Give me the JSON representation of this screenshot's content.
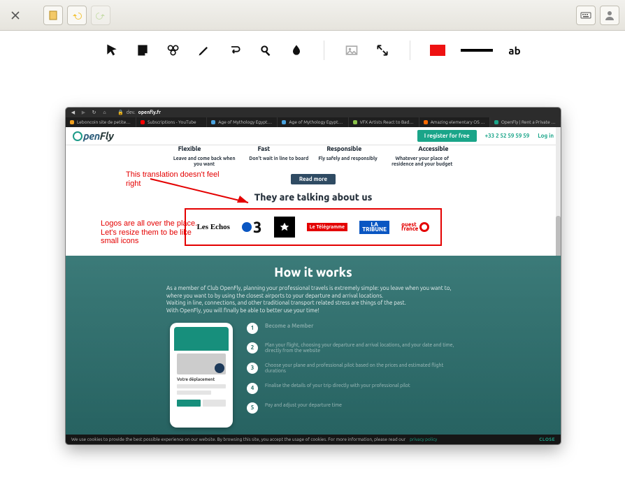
{
  "host": {
    "close": "close",
    "undo": "undo",
    "redo": "redo"
  },
  "tools": {
    "aa": "ab"
  },
  "browser": {
    "url_host": "openfly.fr",
    "url_prefix": "dev.",
    "tabs": [
      {
        "fav": "#f0a020",
        "label": "Leboncoin site de petites annonces g…"
      },
      {
        "fav": "#ff0000",
        "label": "Subscriptions - YouTube"
      },
      {
        "fav": "#4aa3df",
        "label": "Age of Mythology Egypt Campaign P…"
      },
      {
        "fav": "#4aa3df",
        "label": "Age of Mythology Egypt Campaign P…"
      },
      {
        "fav": "#8bc34a",
        "label": "VFX Artists React to Bad & Great CGI…"
      },
      {
        "fav": "#ff6a00",
        "label": "Amazing elementary OS apps that yo…"
      },
      {
        "fav": "#1aa589",
        "label": "OpenFly | Rent a Private Plane"
      }
    ],
    "active_tab": 6
  },
  "site": {
    "brand1": "pen",
    "brand2": "Fly",
    "register": "I register for free",
    "phone": "+33 2 52 59 59 59",
    "login": "Log in",
    "hero_cols": [
      "Flexible",
      "Fast",
      "Responsible",
      "Accessible"
    ],
    "taglines": [
      "Leave and come back when you want",
      "Don't wait in line to board",
      "Fly safely and responsibly",
      "Whatever your place of residence and your budget"
    ],
    "read_more": "Read more",
    "talking": "They are talking about us",
    "logos": {
      "lesechos": "Les Echos",
      "telegramme": "Le Télégramme",
      "tribune_top": "LA",
      "tribune_bot": "TRIBUNE",
      "of_top": "ouest",
      "of_bot": "france"
    },
    "how_title": "How it works",
    "how_intro": [
      "As a member of Club OpenFly, planning your professional travels is extremely simple: you leave when you want to, where you want to by using the closest airports to your departure and arrival locations.",
      "Waiting in line, connections, and other traditional transport related stress are things of the past.",
      "With OpenFly, you will finally be able to better use your time!"
    ],
    "phone_label": "Votre déplacement",
    "steps": [
      {
        "title": "Become a Member",
        "body": ""
      },
      {
        "title": "",
        "body": "Plan your flight, choosing your departure and arrival locations, and your date and time, directly from the website"
      },
      {
        "title": "",
        "body": "Choose your plane and professional pilot based on the prices and estimated flight durations"
      },
      {
        "title": "",
        "body": "Finalise the details of your trip directly with your professional pilot"
      },
      {
        "title": "",
        "body": "Pay and adjust your departure time"
      }
    ],
    "cookie_text": "We use cookies to provide the best possible experience on our website. By browsing this site, you accept the usage of cookies. For more information, please read our",
    "cookie_link": "privacy policy",
    "cookie_close": "CLOSE"
  },
  "annotations": {
    "note1a": "This translation doesn't feel",
    "note1b": "right",
    "note2a": "Logos are all over the place.",
    "note2b": "Let's resize them to be like",
    "note2c": "small icons"
  }
}
